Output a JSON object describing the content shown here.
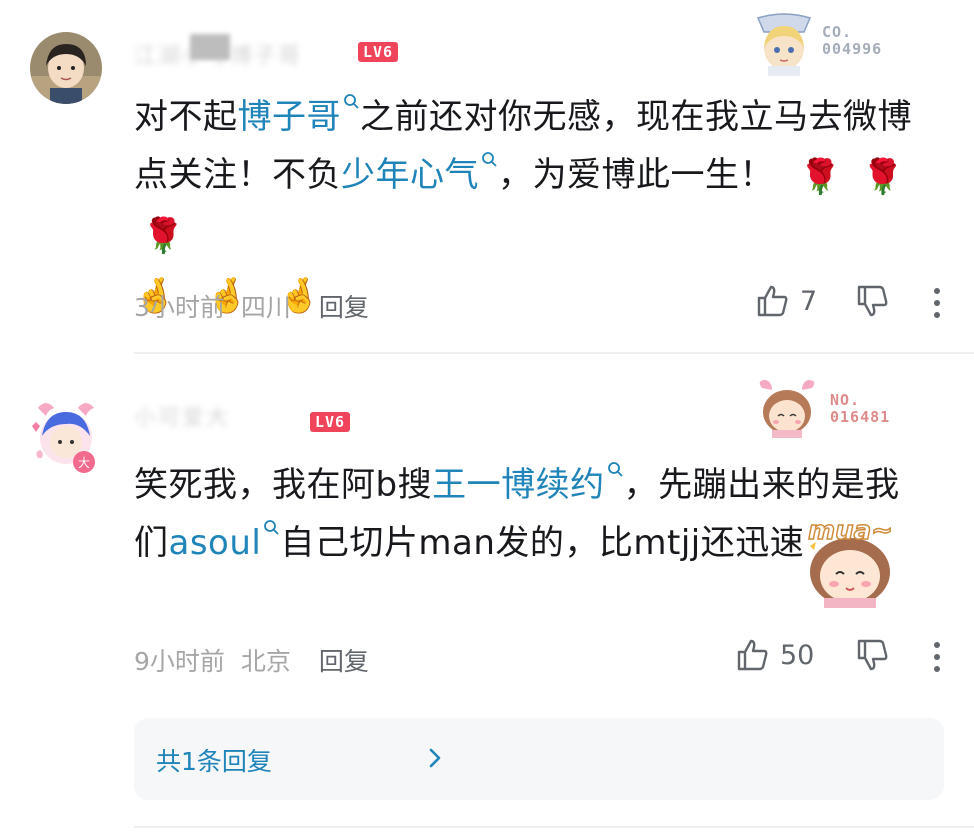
{
  "comments": [
    {
      "username": "江湖小号博子哥",
      "level": "LV6",
      "fan_no": "CO.\n004996",
      "text_parts": [
        {
          "t": "对不起",
          "link": false
        },
        {
          "t": "博子哥",
          "link": true
        },
        {
          "t": "之前还对你无感，现在我立马去微博点关注！不负",
          "link": false
        },
        {
          "t": "少年心气",
          "link": true
        },
        {
          "t": "，为爱博此一生！",
          "link": false
        }
      ],
      "emoji_roses": [
        "🌹",
        "🌹",
        "🌹"
      ],
      "emoji_hands": [
        "🤞",
        "🤞",
        "🤞"
      ],
      "time": "3小时前",
      "location": "四川",
      "reply_label": "回复",
      "likes": "7"
    },
    {
      "username": "小可爱大",
      "level": "LV6",
      "fan_no": "NO.\n016481",
      "text_parts": [
        {
          "t": "笑死我，我在阿b搜",
          "link": false
        },
        {
          "t": "王一博续约",
          "link": true
        },
        {
          "t": "，先蹦出来的是我们",
          "link": false
        },
        {
          "t": "asoul",
          "link": true
        },
        {
          "t": "自己切片man发的，比mtjj还迅速",
          "link": false
        }
      ],
      "sticker_text": "mua~",
      "time": "9小时前",
      "location": "北京",
      "reply_label": "回复",
      "likes": "50",
      "sub_replies_label": "共1条回复"
    }
  ],
  "colors": {
    "link": "#1f84b9",
    "level_badge": "#f0445a",
    "meta": "#a6a6a6"
  }
}
